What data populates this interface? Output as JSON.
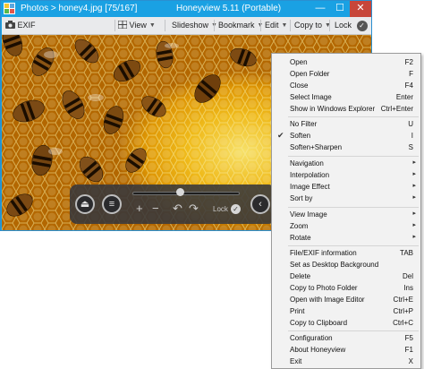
{
  "window": {
    "breadcrumb": "Photos  >  honey4.jpg [75/167]",
    "title": "Honeyview 5.11 (Portable)",
    "minimize": "—",
    "maximize": "☐",
    "close": "✕"
  },
  "toolbar": {
    "exif": "EXIF",
    "view": "View",
    "slideshow": "Slideshow",
    "bookmark": "Bookmark",
    "edit": "Edit",
    "copy_to": "Copy to",
    "lock": "Lock",
    "lock_check": "✓"
  },
  "controls": {
    "eject": "⏏",
    "menu": "≡",
    "zoom_in": "+",
    "zoom_out": "−",
    "rotate_left": "↶",
    "rotate_right": "↷",
    "lock": "Lock",
    "lock_check": "✓",
    "prev": "‹",
    "slider_position": 0.44
  },
  "menu": {
    "items": [
      {
        "label": "Open",
        "key": "F2"
      },
      {
        "label": "Open Folder",
        "key": "F"
      },
      {
        "label": "Close",
        "key": "F4"
      },
      {
        "label": "Select Image",
        "key": "Enter"
      },
      {
        "label": "Show in Windows Explorer",
        "key": "Ctrl+Enter"
      },
      {
        "label": "No Filter",
        "key": "U"
      },
      {
        "label": "Soften",
        "key": "I",
        "checked": "✔"
      },
      {
        "label": "Soften+Sharpen",
        "key": "S"
      },
      {
        "label": "Navigation",
        "key": "▸"
      },
      {
        "label": "Interpolation",
        "key": "▸"
      },
      {
        "label": "Image Effect",
        "key": "▸"
      },
      {
        "label": "Sort by",
        "key": "▸"
      },
      {
        "label": "View Image",
        "key": "▸"
      },
      {
        "label": "Zoom",
        "key": "▸"
      },
      {
        "label": "Rotate",
        "key": "▸"
      },
      {
        "label": "File/EXIF information",
        "key": "TAB"
      },
      {
        "label": "Set as Desktop Background",
        "key": ""
      },
      {
        "label": "Delete",
        "key": "Del"
      },
      {
        "label": "Copy to Photo Folder",
        "key": "Ins"
      },
      {
        "label": "Open with Image Editor",
        "key": "Ctrl+E"
      },
      {
        "label": "Print",
        "key": "Ctrl+P"
      },
      {
        "label": "Copy to Clipboard",
        "key": "Ctrl+C"
      },
      {
        "label": "Configuration",
        "key": "F5"
      },
      {
        "label": "About Honeyview",
        "key": "F1"
      },
      {
        "label": "Exit",
        "key": "X"
      }
    ]
  }
}
